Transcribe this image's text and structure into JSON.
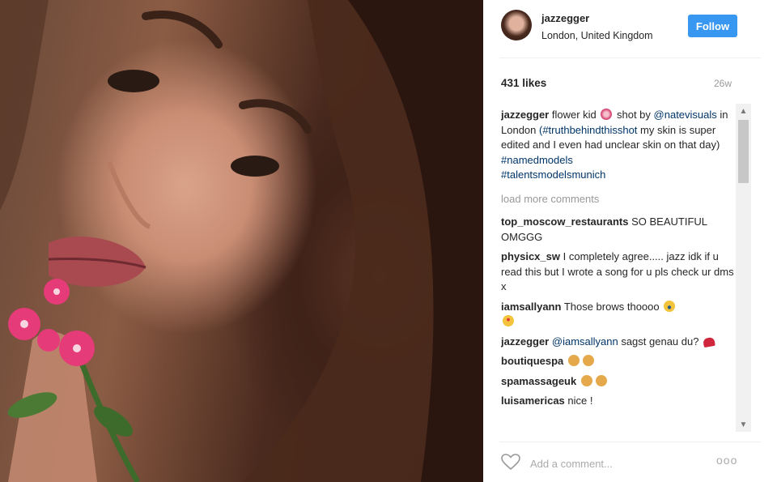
{
  "post": {
    "username": "jazzegger",
    "location": "London, United Kingdom",
    "follow_label": "Follow",
    "likes": "431 likes",
    "time_ago": "26w"
  },
  "caption": {
    "user": "jazzegger",
    "text_1": " flower kid ",
    "emoji_1": "flower-emoji",
    "text_2": " shot by ",
    "mention": "@natevisuals",
    "text_3": " in London ",
    "hashtag_1": "(#truthbehindthisshot",
    "text_4": " my skin is super edited and I even had unclear skin on that day) ",
    "hashtag_2": "#namedmodels",
    "hashtag_3": "#talentsmodelsmunich"
  },
  "load_more": "load more comments",
  "comments": [
    {
      "user": "top_moscow_restaurants",
      "text": " SO BEAUTIFUL OMGGG"
    },
    {
      "user": "physicx_sw",
      "text": " I completely agree..... jazz idk if u read this but I wrote a song for u pls check ur dms x"
    },
    {
      "user": "iamsallyann",
      "text": " Those brows thoooo "
    },
    {
      "user": "jazzegger",
      "mention": "@iamsallyann",
      "text": " sagst genau du? "
    },
    {
      "user": "boutiquespa",
      "text": " "
    },
    {
      "user": "spamassageuk",
      "text": " "
    },
    {
      "user": "luisamericas",
      "text": " nice !"
    }
  ],
  "footer": {
    "add_comment_placeholder": "Add a comment...",
    "more_label": "ooo"
  },
  "colors": {
    "follow_button": "#3897f0",
    "link": "#003569",
    "muted": "#999999"
  }
}
